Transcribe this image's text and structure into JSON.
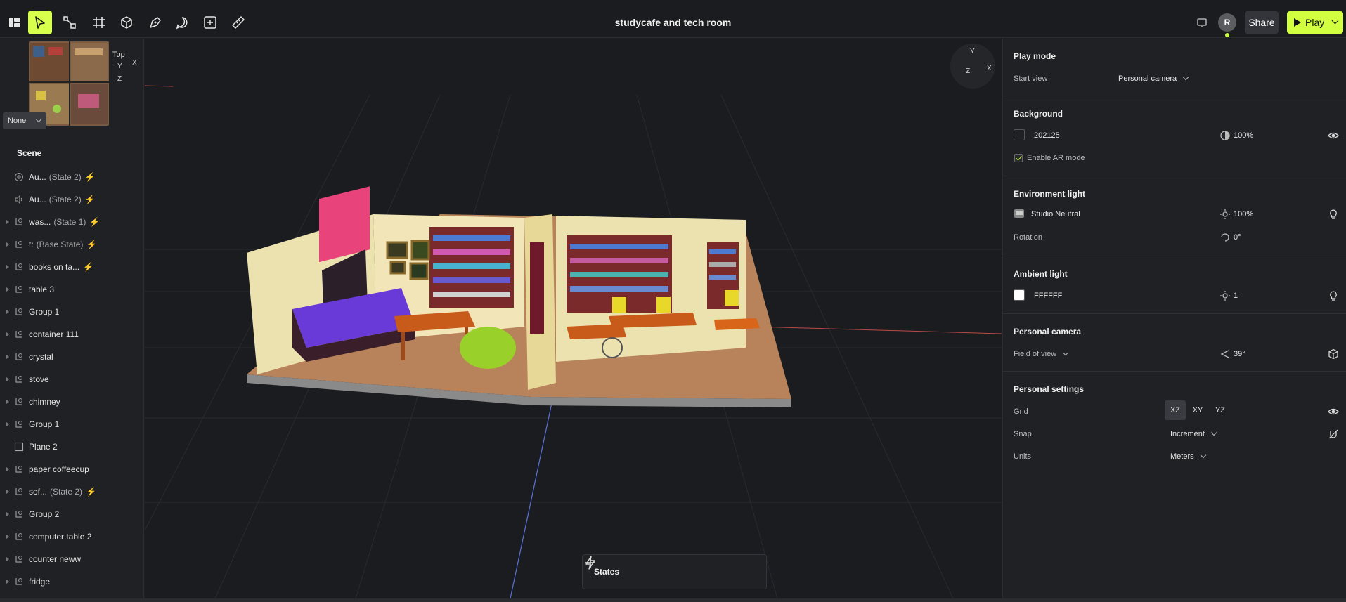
{
  "toolbar": {
    "title": "studycafe and tech room",
    "share_label": "Share",
    "play_label": "Play",
    "avatar_initial": "R",
    "accent": "#d2ff3f"
  },
  "left": {
    "minimap_label": "Top",
    "axis_y": "Y",
    "axis_x": "X",
    "axis_z": "Z",
    "view_select": "None",
    "scene_title": "Scene",
    "items": [
      {
        "name": "Au...",
        "state": "(State 2)",
        "bolt": true,
        "icon": "audio-icon",
        "expand": false
      },
      {
        "name": "Au...",
        "state": "(State 2)",
        "bolt": true,
        "icon": "speaker-icon",
        "expand": false
      },
      {
        "name": "was...",
        "state": "(State 1)",
        "bolt": true,
        "icon": "group-icon",
        "expand": true
      },
      {
        "name": "t:",
        "state": "(Base State)",
        "bolt": true,
        "icon": "group-icon",
        "expand": true
      },
      {
        "name": "books on ta...",
        "state": "",
        "bolt": true,
        "icon": "group-icon",
        "expand": true
      },
      {
        "name": "table 3",
        "state": "",
        "bolt": false,
        "icon": "group-icon",
        "expand": true
      },
      {
        "name": "Group 1",
        "state": "",
        "bolt": false,
        "icon": "group-icon",
        "expand": true
      },
      {
        "name": "container 111",
        "state": "",
        "bolt": false,
        "icon": "group-icon",
        "expand": true
      },
      {
        "name": "crystal",
        "state": "",
        "bolt": false,
        "icon": "group-icon",
        "expand": true
      },
      {
        "name": "stove",
        "state": "",
        "bolt": false,
        "icon": "group-icon",
        "expand": true
      },
      {
        "name": "chimney",
        "state": "",
        "bolt": false,
        "icon": "group-icon",
        "expand": true
      },
      {
        "name": "Group 1",
        "state": "",
        "bolt": false,
        "icon": "group-icon",
        "expand": true
      },
      {
        "name": "Plane 2",
        "state": "",
        "bolt": false,
        "icon": "plane-icon",
        "expand": false
      },
      {
        "name": "paper coffeecup",
        "state": "",
        "bolt": false,
        "icon": "group-icon",
        "expand": true
      },
      {
        "name": "sof...",
        "state": "(State 2)",
        "bolt": true,
        "icon": "group-icon",
        "expand": true
      },
      {
        "name": "Group 2",
        "state": "",
        "bolt": false,
        "icon": "group-icon",
        "expand": true
      },
      {
        "name": "computer table 2",
        "state": "",
        "bolt": false,
        "icon": "group-icon",
        "expand": true
      },
      {
        "name": "counter neww",
        "state": "",
        "bolt": false,
        "icon": "group-icon",
        "expand": true
      },
      {
        "name": "fridge",
        "state": "",
        "bolt": false,
        "icon": "group-icon",
        "expand": true
      }
    ]
  },
  "viewport": {
    "gizmo_y": "Y",
    "gizmo_x": "X",
    "gizmo_z": "Z",
    "states_label": "States"
  },
  "right": {
    "play_mode": {
      "title": "Play mode",
      "start_view_label": "Start view",
      "start_view_value": "Personal camera"
    },
    "background": {
      "title": "Background",
      "color": "202125",
      "color_hex": "#202125",
      "opacity": "100%",
      "ar_label": "Enable AR mode"
    },
    "environment": {
      "title": "Environment light",
      "preset": "Studio Neutral",
      "intensity": "100%",
      "rotation_label": "Rotation",
      "rotation_value": "0°"
    },
    "ambient": {
      "title": "Ambient light",
      "color": "FFFFFF",
      "color_hex": "#FFFFFF",
      "intensity": "1"
    },
    "camera": {
      "title": "Personal camera",
      "fov_label": "Field of view",
      "fov_value": "39°"
    },
    "settings": {
      "title": "Personal settings",
      "grid_label": "Grid",
      "grid_options": [
        "XZ",
        "XY",
        "YZ"
      ],
      "snap_label": "Snap",
      "snap_value": "Increment",
      "units_label": "Units",
      "units_value": "Meters"
    }
  }
}
